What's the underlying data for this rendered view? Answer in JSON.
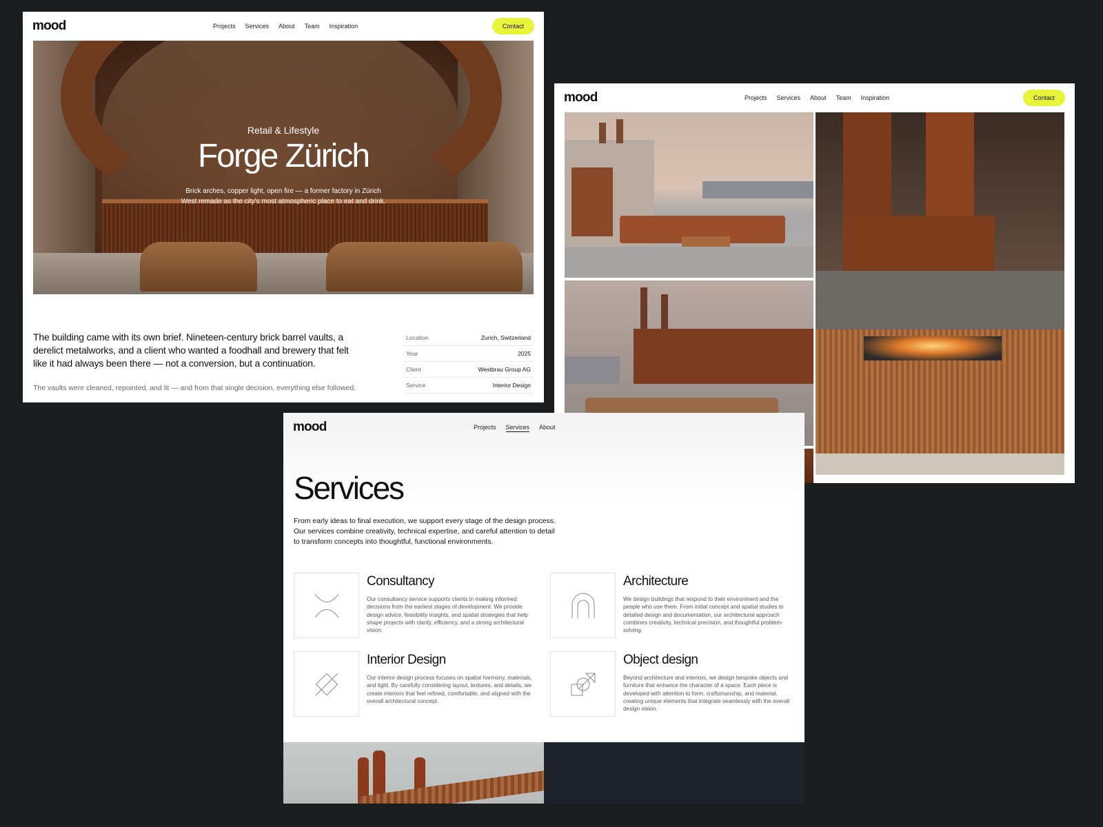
{
  "brand": {
    "logo": "mood",
    "accent": "#e8f43a",
    "background": "#1b1c1e"
  },
  "nav": {
    "items": [
      "Projects",
      "Services",
      "About",
      "Team",
      "Inspiration"
    ],
    "contact": "Contact"
  },
  "project": {
    "category": "Retail & Lifestyle",
    "title": "Forge Zürich",
    "description_line1": "Brick arches, copper light, open fire — a former factory in Zürich",
    "description_line2": "West remade as the city's most atmospheric place to eat and drink.",
    "intro": "The building came with its own brief. Nineteen-century brick barrel vaults, a derelict metalworks, and a client who wanted a foodhall and brewery that felt like it had always been there — not a conversion, but a continuation.",
    "note": "The vaults were cleaned, repointed, and lit — and from that single decision, everything else followed.",
    "facts": [
      {
        "label": "Location",
        "value": "Zurich, Switzerland"
      },
      {
        "label": "Year",
        "value": "2025"
      },
      {
        "label": "Client",
        "value": "Westbrau Group AG"
      },
      {
        "label": "Service",
        "value": "Interior Design"
      }
    ]
  },
  "gallery": {
    "images": [
      "rooftop-terrace-photo",
      "corten-terrace-photo",
      "brick-vault-photo",
      "open-fire-kitchen-photo"
    ]
  },
  "services_page": {
    "nav_visible": [
      "Projects",
      "Services",
      "About"
    ],
    "active": "Services",
    "title": "Services",
    "intro": "From early ideas to final execution, we support every stage of the design process. Our services combine creativity, technical expertise, and careful attention to detail to transform concepts into thoughtful, functional environments.",
    "cards": [
      {
        "title": "Consultancy",
        "icon": "consultancy-icon",
        "desc": "Our consultancy service supports clients in making informed decisions from the earliest stages of development. We provide design advice, feasibility insights, and spatial strategies that help shape projects with clarity, efficiency, and a strong architectural vision."
      },
      {
        "title": "Architecture",
        "icon": "arch-icon",
        "desc": "We design buildings that respond to their environment and the people who use them. From initial concept and spatial studies to detailed design and documentation, our architectural approach combines creativity, technical precision, and thoughtful problem-solving."
      },
      {
        "title": "Interior Design",
        "icon": "diamond-icon",
        "desc": "Our interior design process focuses on spatial harmony, materials, and light. By carefully considering layout, textures, and details, we create interiors that feel refined, comfortable, and aligned with the overall architectural concept."
      },
      {
        "title": "Object design",
        "icon": "object-icon",
        "desc": "Beyond architecture and interiors, we design bespoke objects and furniture that enhance the character of a space. Each piece is developed with attention to form, craftsmanship, and material, creating unique elements that integrate seamlessly with the overall design vision."
      }
    ]
  }
}
